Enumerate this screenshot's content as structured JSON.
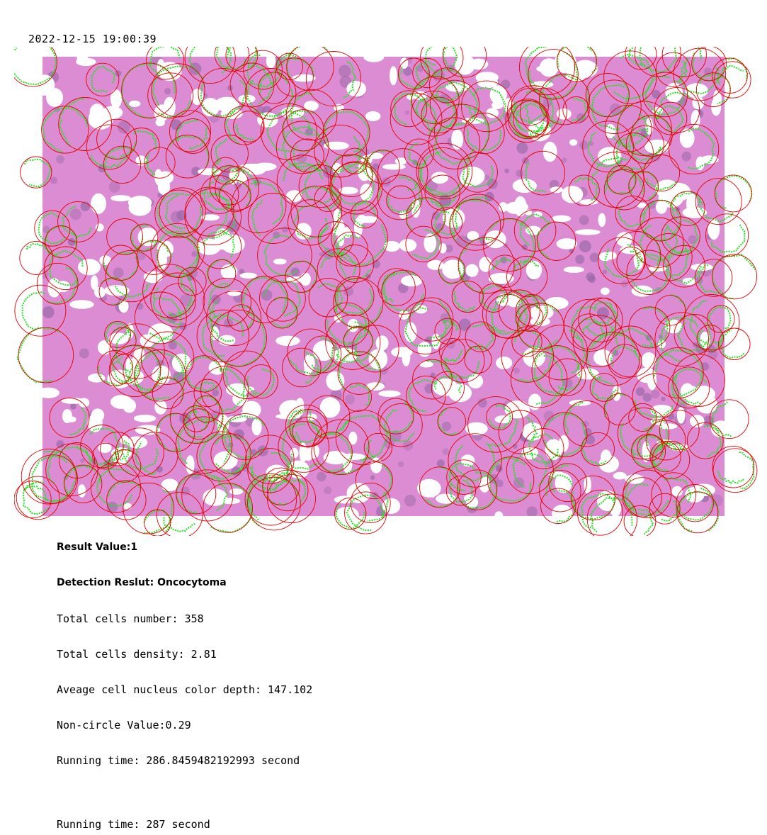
{
  "timestamp": "2022-12-15 19:00:39",
  "colors": {
    "tissue_pink": "#dc8cd2",
    "tissue_dark": "#9a6aa8",
    "lumen_white": "#ffffff",
    "circle_red": "#e60000",
    "contour_green": "#1ee61e"
  },
  "results": {
    "result_value": "Result Value:1",
    "detection_result": "Detection Reslut: Oncocytoma",
    "total_cells": "Total cells number: 358",
    "density": "Total cells density: 2.81",
    "color_depth": "Aveage cell nucleus color depth: 147.102",
    "non_circle": "Non-circle Value:0.29",
    "running_time_precise": "Running time: 286.8459482192993 second",
    "running_time_rounded": "Running time: 287 second"
  }
}
